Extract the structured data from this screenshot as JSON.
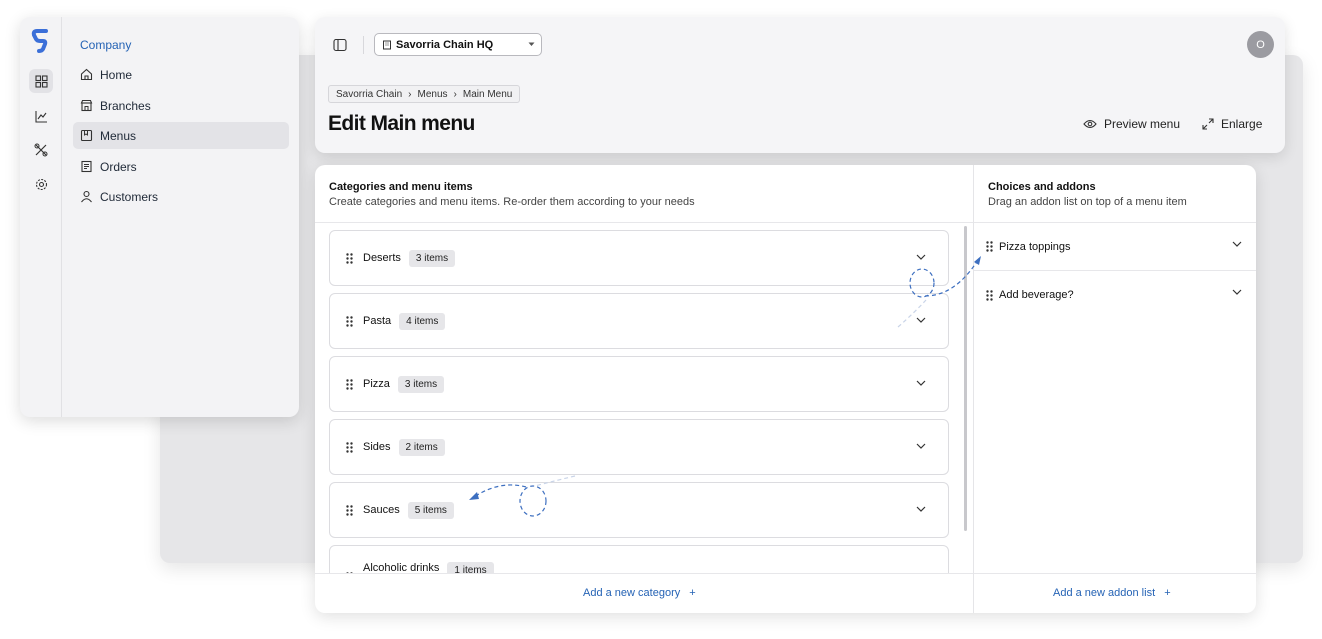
{
  "sidebar": {
    "section_title": "Company",
    "items": [
      {
        "label": "Home",
        "icon": "home-icon",
        "active": false
      },
      {
        "label": "Branches",
        "icon": "store-icon",
        "active": false
      },
      {
        "label": "Menus",
        "icon": "menu-book-icon",
        "active": true
      },
      {
        "label": "Orders",
        "icon": "receipt-icon",
        "active": false
      },
      {
        "label": "Customers",
        "icon": "user-icon",
        "active": false
      }
    ],
    "rail_icons": [
      "dashboard-icon",
      "chart-icon",
      "tools-icon",
      "settings-icon"
    ]
  },
  "header": {
    "branch_select": "Savorria Chain HQ",
    "avatar_initial": "O",
    "breadcrumb": [
      "Savorria Chain",
      "Menus",
      "Main Menu"
    ],
    "breadcrumb_separator": "›",
    "title": "Edit Main menu",
    "preview_label": "Preview menu",
    "enlarge_label": "Enlarge"
  },
  "categories": {
    "title": "Categories and menu items",
    "subtitle": "Create categories and menu items. Re-order them according to your needs",
    "items": [
      {
        "name": "Deserts",
        "count": "3 items"
      },
      {
        "name": "Pasta",
        "count": "4 items"
      },
      {
        "name": "Pizza",
        "count": "3 items"
      },
      {
        "name": "Sides",
        "count": "2 items"
      },
      {
        "name": "Sauces",
        "count": "5 items"
      },
      {
        "name": "Alcoholic drinks",
        "count": "1 items"
      }
    ],
    "add_label": "Add a new category",
    "add_symbol": "+"
  },
  "addons": {
    "title": "Choices and addons",
    "subtitle": "Drag an addon list on top of a menu item",
    "items": [
      {
        "name": "Pizza toppings"
      },
      {
        "name": "Add beverage?"
      }
    ],
    "add_label": "Add a new addon list",
    "add_symbol": "+"
  },
  "colors": {
    "accent": "#2563b5",
    "logo": "#3b6fd8",
    "annotation": "#3d6fc0"
  }
}
